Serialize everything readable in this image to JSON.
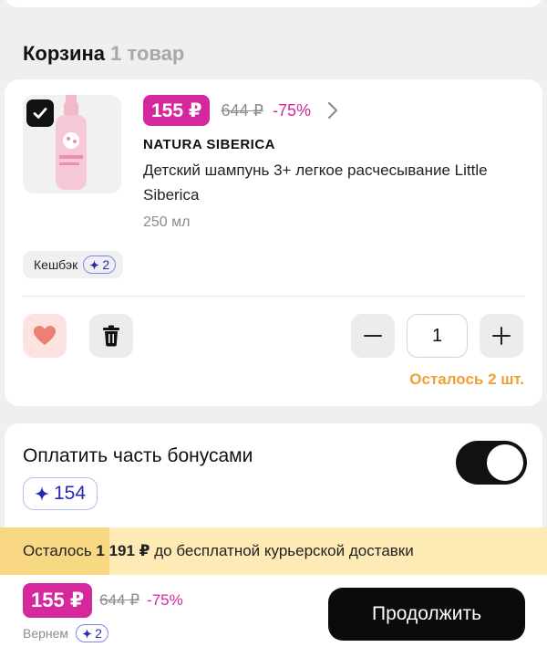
{
  "cart": {
    "title": "Корзина",
    "count_label": "1 товар"
  },
  "item": {
    "selected": true,
    "price": "155 ₽",
    "old_price": "644 ₽",
    "discount": "-75%",
    "brand": "NATURA SIBERICA",
    "name": "Детский шампунь 3+ легкое расчесывание Little Siberica",
    "volume": "250 мл",
    "cashback_label": "Кешбэк",
    "cashback_value": "2",
    "quantity": "1",
    "stock_note": "Осталось 2 шт."
  },
  "bonuses": {
    "title": "Оплатить часть бонусами",
    "balance": "154",
    "toggle_on": true
  },
  "delivery": {
    "prefix": "Осталось ",
    "amount": "1 191 ₽",
    "suffix": " до бесплатной курьерской доставки",
    "progress": 0.2
  },
  "footer": {
    "price": "155 ₽",
    "old_price": "644 ₽",
    "discount": "-75%",
    "return_label": "Вернем",
    "return_value": "2",
    "continue_label": "Продолжить"
  },
  "colors": {
    "accent_pink": "#d4289c",
    "stock_orange": "#f0a032",
    "bonus_blue": "#2a2ab0",
    "delivery_bg": "#fdeab4"
  },
  "icons": [
    "checkmark-icon",
    "chevron-right-icon",
    "heart-icon",
    "trash-icon",
    "minus-icon",
    "plus-icon",
    "sparkle-icon"
  ]
}
